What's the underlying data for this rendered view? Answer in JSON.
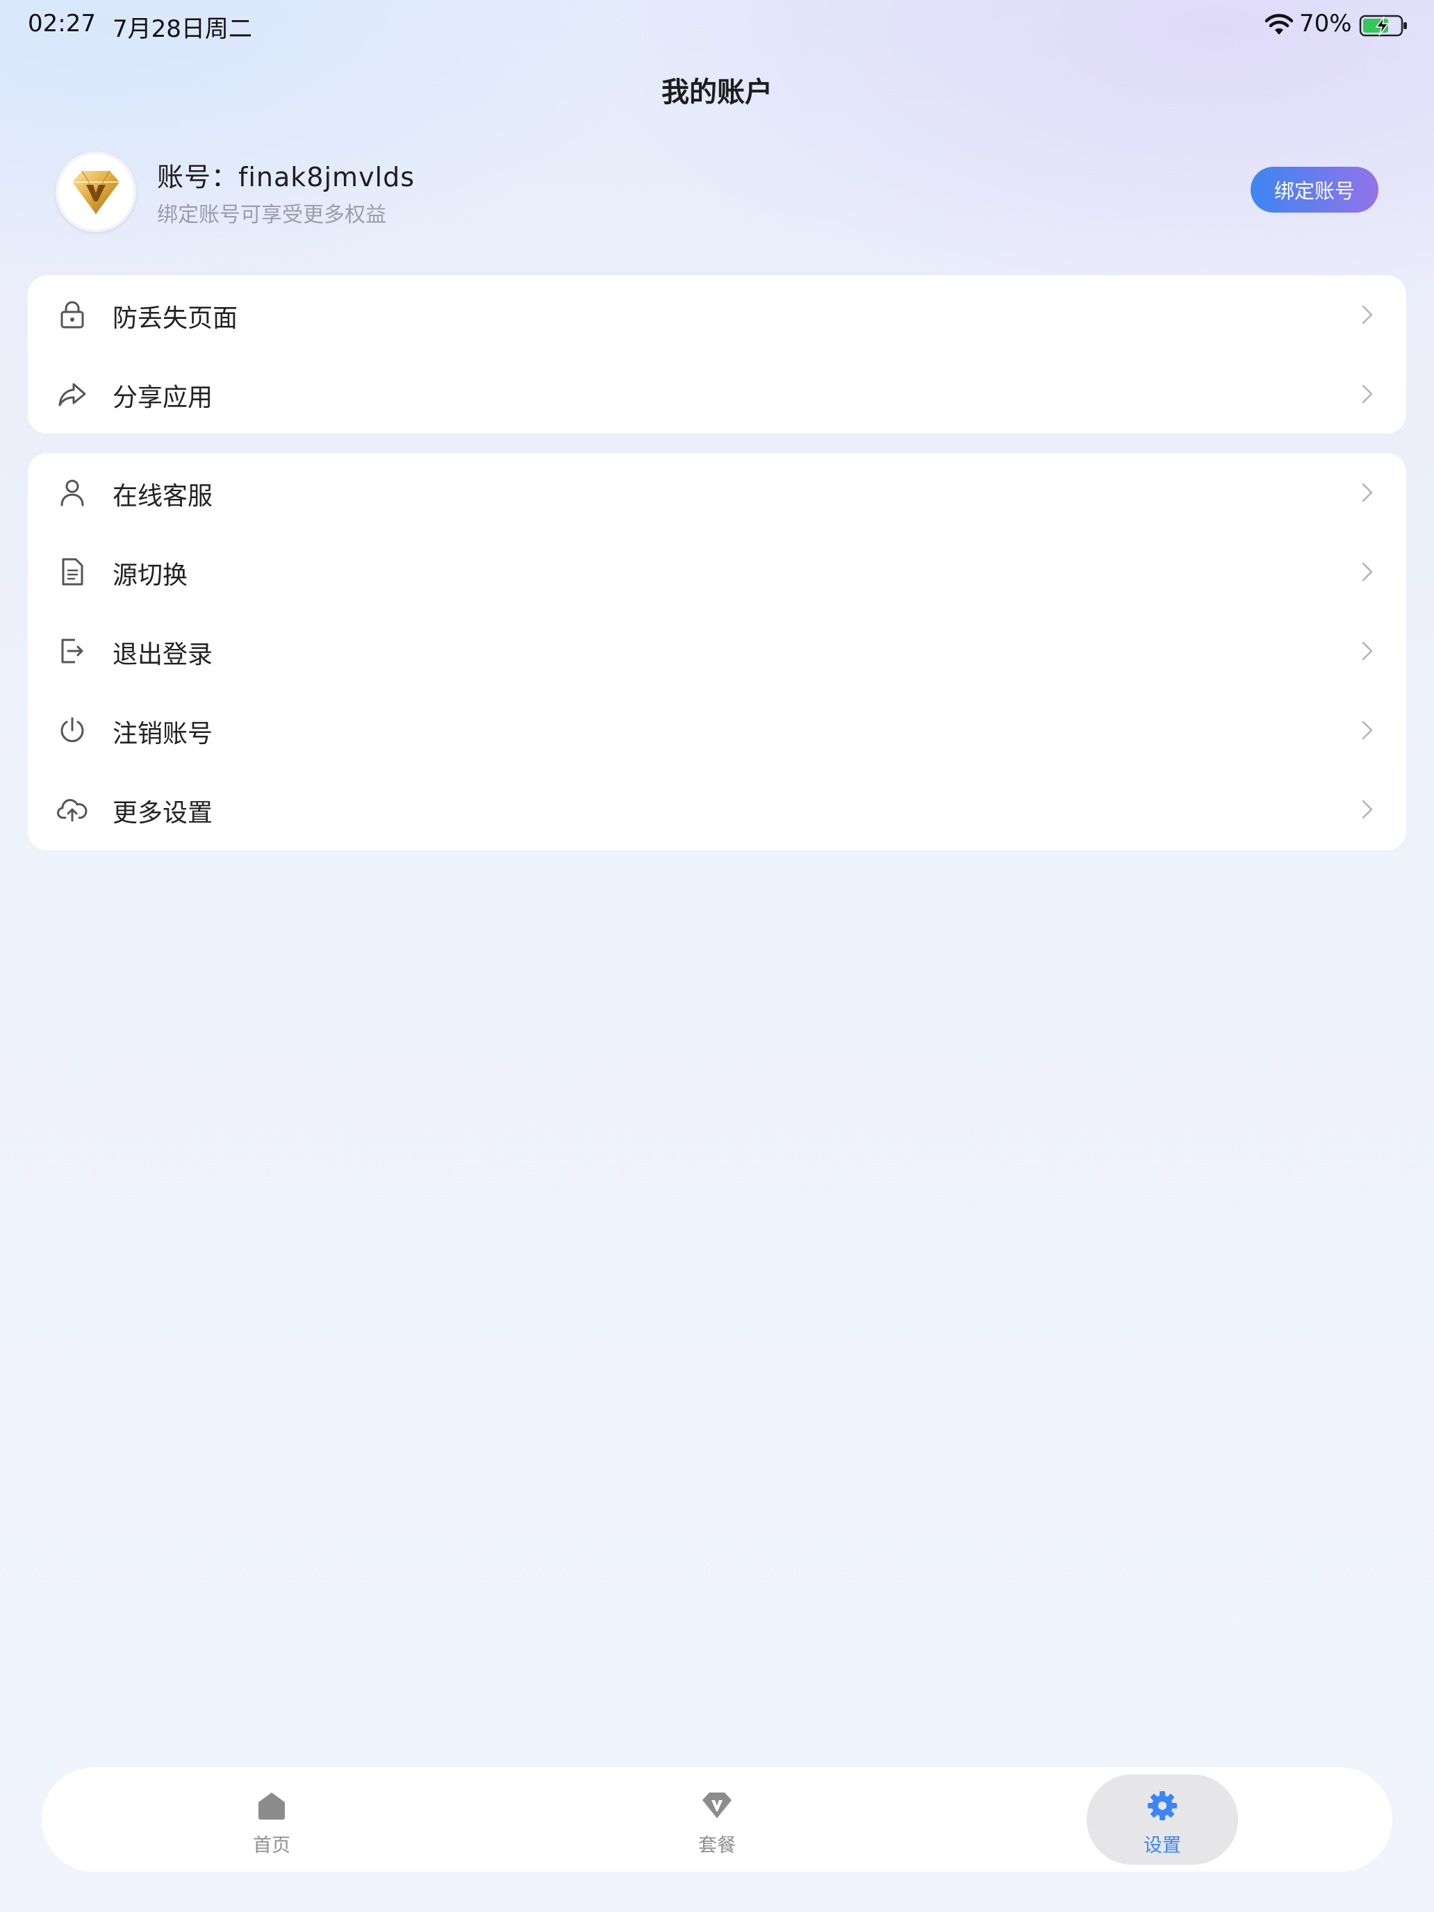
{
  "status_bar": {
    "time": "02:27",
    "date": "7月28日周二",
    "battery": "70%"
  },
  "header": {
    "title": "我的账户"
  },
  "profile": {
    "account_name": "账号：finak8jmvlds",
    "hint": "绑定账号可享受更多权益",
    "bind_button": "绑定账号"
  },
  "menu_group_1": [
    {
      "label": "防丢失页面",
      "icon": "lock-icon"
    },
    {
      "label": "分享应用",
      "icon": "share-icon"
    }
  ],
  "menu_group_2": [
    {
      "label": "在线客服",
      "icon": "person-icon"
    },
    {
      "label": "源切换",
      "icon": "document-icon"
    },
    {
      "label": "退出登录",
      "icon": "logout-icon"
    },
    {
      "label": "注销账号",
      "icon": "power-icon"
    },
    {
      "label": "更多设置",
      "icon": "cloud-upload-icon"
    }
  ],
  "bottom_nav": {
    "tabs": [
      {
        "label": "首页",
        "icon": "home-icon",
        "active": false
      },
      {
        "label": "套餐",
        "icon": "diamond-icon",
        "active": false
      },
      {
        "label": "设置",
        "icon": "gear-icon",
        "active": true
      }
    ]
  },
  "colors": {
    "accent": "#3b86f4",
    "button_gradient_start": "#3d86f0",
    "button_gradient_end": "#9373e8",
    "battery_green": "#34c759"
  }
}
